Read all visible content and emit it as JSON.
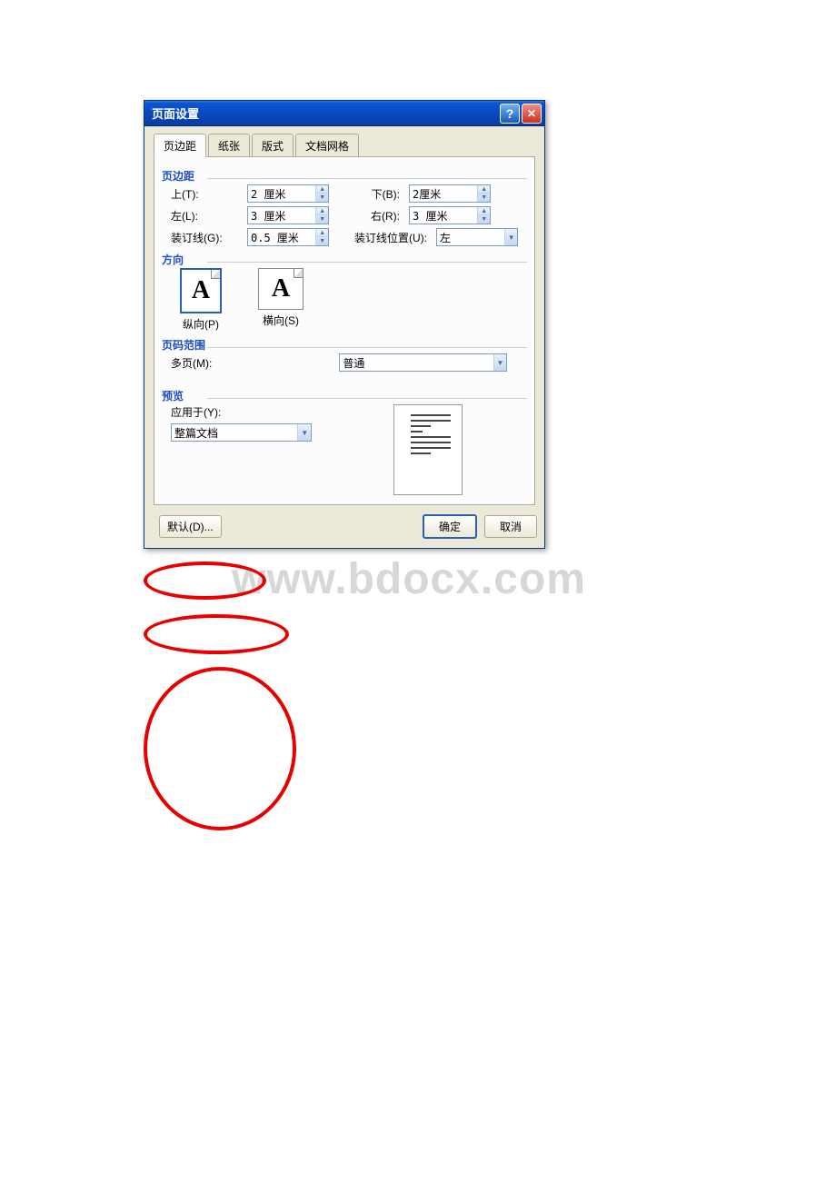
{
  "title": "页面设置",
  "tabs": [
    "页边距",
    "纸张",
    "版式",
    "文档网格"
  ],
  "margins": {
    "legend": "页边距",
    "top_label": "上(T):",
    "top_value": "2 厘米",
    "bottom_label": "下(B):",
    "bottom_value": "2厘米",
    "left_label": "左(L):",
    "left_value": "3 厘米",
    "right_label": "右(R):",
    "right_value": "3 厘米",
    "gutter_label": "装订线(G):",
    "gutter_value": "0.5 厘米",
    "gutter_pos_label": "装订线位置(U):",
    "gutter_pos_value": "左"
  },
  "orientation": {
    "legend": "方向",
    "portrait_label": "纵向(P)",
    "landscape_label": "横向(S)"
  },
  "page_range": {
    "legend": "页码范围",
    "multi_label": "多页(M):",
    "multi_value": "普通"
  },
  "preview": {
    "legend": "预览",
    "apply_label": "应用于(Y):",
    "apply_value": "整篇文档"
  },
  "footer": {
    "default_btn": "默认(D)...",
    "ok_btn": "确定",
    "cancel_btn": "取消"
  },
  "watermark": "www.bdocx.com"
}
